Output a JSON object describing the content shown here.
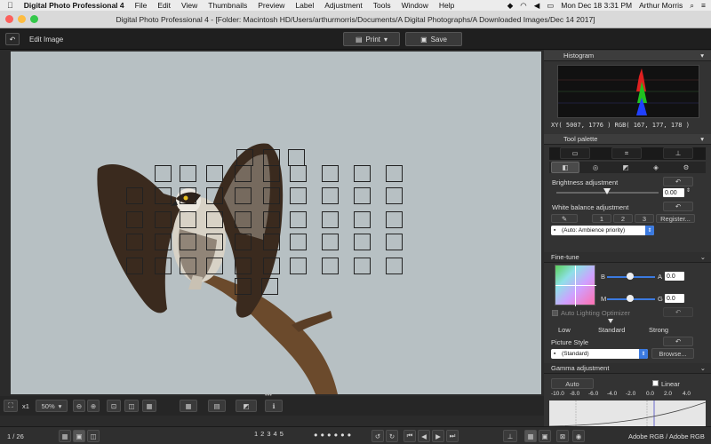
{
  "menubar": {
    "apple_icon": "apple-logo",
    "app": "Digital Photo Professional 4",
    "items": [
      "File",
      "Edit",
      "View",
      "Thumbnails",
      "Preview",
      "Label",
      "Adjustment",
      "Tools",
      "Window",
      "Help"
    ],
    "datetime": "Mon Dec 18  3:31 PM",
    "user": "Arthur Morris"
  },
  "window": {
    "title": "Digital Photo Professional 4 - [Folder: Macintosh HD/Users/arthurmorris/Documents/A Digital Photographs/A Downloaded Images/Dec 14 2017]"
  },
  "toolbar": {
    "back_icon": "return-icon",
    "mode_label": "Edit Image",
    "print_label": "Print",
    "save_label": "Save"
  },
  "bottom": {
    "zoom_prefix": "x1",
    "zoom_value": "50%",
    "page_indicator": "1 / 26",
    "star_labels": [
      "1",
      "2",
      "3",
      "4",
      "5"
    ],
    "color_profile": "Adobe RGB / Adobe RGB"
  },
  "histogram": {
    "title": "Histogram",
    "readout": "XY(  5007,  1776 )  RGB( 167,  177,  178 )"
  },
  "tool_palette": {
    "title": "Tool palette",
    "brightness_label": "Brightness adjustment",
    "brightness_value": "0.00",
    "wb_label": "White balance adjustment",
    "wb_buttons": [
      "1",
      "2",
      "3"
    ],
    "register_label": "Register...",
    "wb_select": "(Auto: Ambience priority)"
  },
  "fine_tune": {
    "title": "Fine-tune",
    "b_label": "B",
    "a_label": "A",
    "m_label": "M",
    "g_label": "G",
    "a_value": "0.0",
    "g_value": "0.0",
    "alo_label": "Auto Lighting Optimizer",
    "alo_levels": [
      "Low",
      "Standard",
      "Strong"
    ],
    "picture_style_label": "Picture Style",
    "picture_style_value": "(Standard)",
    "browse_label": "Browse..."
  },
  "gamma": {
    "title": "Gamma adjustment",
    "auto_label": "Auto",
    "linear_label": "Linear",
    "scale": [
      "-10.0",
      "-8.0",
      "-6.0",
      "-4.0",
      "-2.0",
      "0.0",
      "2.0",
      "4.0"
    ]
  },
  "colors": {
    "accent": "#3b7ae0",
    "canvas_bg": "#b7c0c3",
    "panel_bg": "#333333"
  }
}
